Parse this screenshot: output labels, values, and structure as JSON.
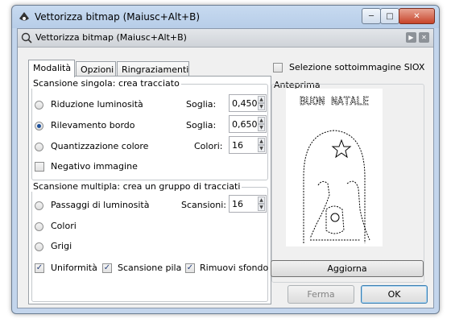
{
  "window": {
    "title": "Vettorizza bitmap (Maiusc+Alt+B)"
  },
  "dock": {
    "title": "Vettorizza bitmap (Maiusc+Alt+B)"
  },
  "tabs": [
    "Modalità",
    "Opzioni",
    "Ringraziamenti"
  ],
  "single_scan": {
    "legend": "Scansione singola: crea tracciato",
    "options": [
      {
        "label": "Riduzione luminosità",
        "param_label": "Soglia:",
        "value": "0,450",
        "selected": false
      },
      {
        "label": "Rilevamento bordo",
        "param_label": "Soglia:",
        "value": "0,650",
        "selected": true
      },
      {
        "label": "Quantizzazione colore",
        "param_label": "Colori:",
        "value": "16",
        "selected": false
      }
    ],
    "invert_label": "Negativo immagine"
  },
  "multi_scan": {
    "legend": "Scansione multipla: crea un gruppo di tracciati",
    "options": [
      {
        "label": "Passaggi di luminosità",
        "selected": false
      },
      {
        "label": "Colori",
        "selected": false
      },
      {
        "label": "Grigi",
        "selected": false
      }
    ],
    "scans_label": "Scansioni:",
    "scans_value": "16",
    "checks": [
      {
        "label": "Uniformità",
        "checked": true
      },
      {
        "label": "Scansione pila",
        "checked": true
      },
      {
        "label": "Rimuovi sfondo",
        "checked": true
      }
    ]
  },
  "siox": {
    "label": "Selezione sottoimmagine SIOX",
    "checked": false
  },
  "preview": {
    "legend": "Anteprima",
    "image_caption": "BUON NATALE",
    "update_label": "Aggiorna"
  },
  "buttons": {
    "stop": "Ferma",
    "ok": "OK"
  }
}
